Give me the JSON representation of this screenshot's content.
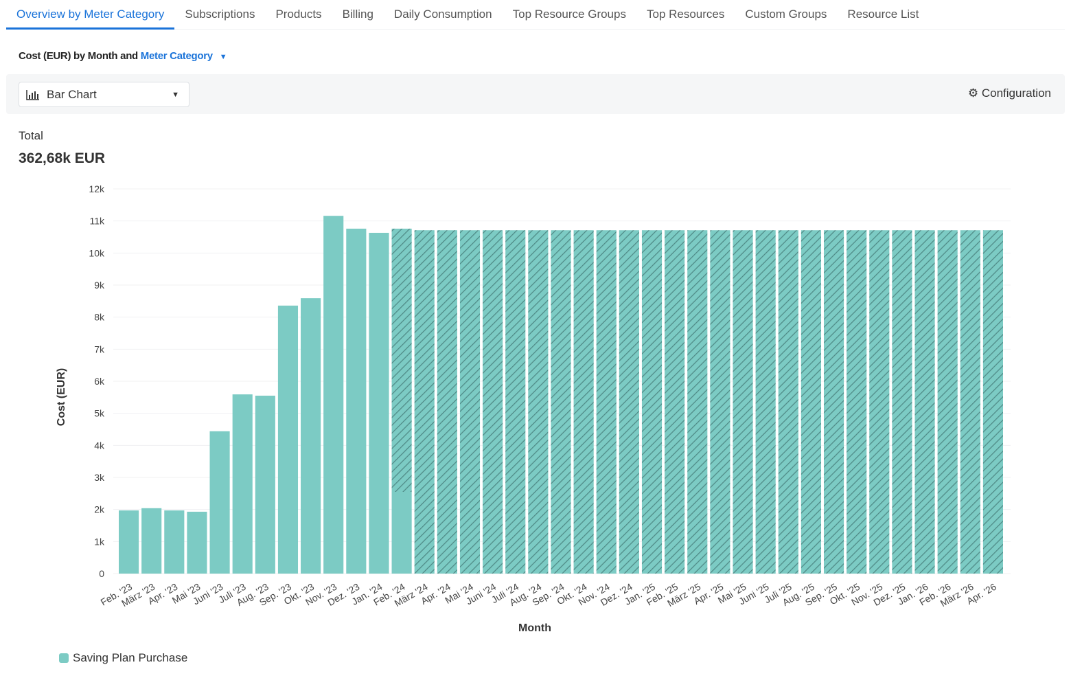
{
  "tabs": [
    "Overview by Meter Category",
    "Subscriptions",
    "Products",
    "Billing",
    "Daily Consumption",
    "Top Resource Groups",
    "Top Resources",
    "Custom Groups",
    "Resource List"
  ],
  "subtitle": {
    "prefix": "Cost (EUR) by Month and",
    "dimension": "Meter Category"
  },
  "toolbar": {
    "chart_type": "Bar Chart",
    "configuration": "Configuration"
  },
  "total": {
    "label": "Total",
    "value": "362,68k EUR"
  },
  "colors": {
    "accent": "#1a73d9",
    "bar": "#7ccbc4",
    "hatch": "#4f8a86"
  },
  "chart_data": {
    "type": "bar",
    "xlabel": "Month",
    "ylabel": "Cost (EUR)",
    "ylim": [
      0,
      12000
    ],
    "yticks": [
      "0",
      "1k",
      "2k",
      "3k",
      "4k",
      "5k",
      "6k",
      "7k",
      "8k",
      "9k",
      "10k",
      "11k",
      "12k"
    ],
    "categories": [
      "Feb. '23",
      "März '23",
      "Apr. '23",
      "Mai '23",
      "Juni '23",
      "Juli '23",
      "Aug. '23",
      "Sep. '23",
      "Okt. '23",
      "Nov. '23",
      "Dez. '23",
      "Jan. '24",
      "Feb. '24",
      "März '24",
      "Apr. '24",
      "Mai '24",
      "Juni '24",
      "Juli '24",
      "Aug. '24",
      "Sep. '24",
      "Okt. '24",
      "Nov. '24",
      "Dez. '24",
      "Jan. '25",
      "Feb. '25",
      "März '25",
      "Apr. '25",
      "Mai '25",
      "Juni '25",
      "Juli '25",
      "Aug. '25",
      "Sep. '25",
      "Okt. '25",
      "Nov. '25",
      "Dez. '25",
      "Jan. '26",
      "Feb. '26",
      "März '26",
      "Apr. '26"
    ],
    "series": [
      {
        "name": "Saving Plan Purchase",
        "actual": [
          1970,
          2040,
          1970,
          1930,
          4440,
          5590,
          5550,
          8360,
          8590,
          11160,
          10760,
          10630,
          2550,
          0,
          0,
          0,
          0,
          0,
          0,
          0,
          0,
          0,
          0,
          0,
          0,
          0,
          0,
          0,
          0,
          0,
          0,
          0,
          0,
          0,
          0,
          0,
          0,
          0,
          0
        ],
        "forecast": [
          0,
          0,
          0,
          0,
          0,
          0,
          0,
          0,
          0,
          0,
          0,
          0,
          8210,
          10710,
          10710,
          10710,
          10710,
          10710,
          10710,
          10710,
          10710,
          10710,
          10710,
          10710,
          10710,
          10710,
          10710,
          10710,
          10710,
          10710,
          10710,
          10710,
          10710,
          10710,
          10710,
          10710,
          10710,
          10710,
          10710
        ]
      }
    ],
    "legend": "bottom-left",
    "grid": true
  }
}
